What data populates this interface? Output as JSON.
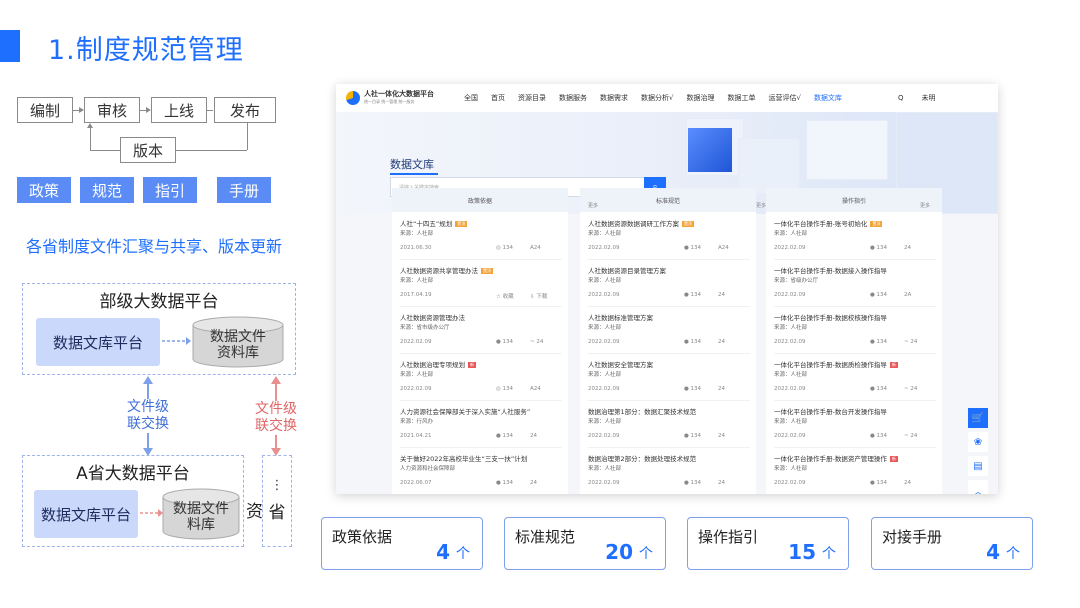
{
  "slide": {
    "title": "1.制度规范管理"
  },
  "flow": {
    "step1": "编制",
    "step2": "审核",
    "step3": "上线",
    "step4": "发布",
    "version": "版本"
  },
  "tags": [
    "政策",
    "规范",
    "指引",
    "手册"
  ],
  "subtitle": "各省制度文件汇聚与共享、版本更新",
  "diagram": {
    "ministry_title": "部级大数据平台",
    "doc_lib_platform": "数据文库平台",
    "data_file_repo_line1": "数据文件",
    "data_file_repo_line2": "资料库",
    "exchange_left_line1": "文件级",
    "exchange_left_line2": "联交换",
    "exchange_right_line1": "文件级",
    "exchange_right_line2": "联交换",
    "province_title": "A省大数据平台",
    "province_doc_lib_platform": "数据文库平台",
    "province_repo_line1": "数据文件",
    "province_repo_line2": "料库",
    "partial_cut": "资",
    "partial_box_dots": "⋮",
    "partial_box_text": "省",
    "exchange_left_color": "#3f6fd8",
    "exchange_right_color": "#e06666"
  },
  "portal": {
    "brand_main": "人社一体化大数据平台",
    "brand_sub": "统一目录 统一管理 统一服务",
    "nav": [
      "全国",
      "首页",
      "资源目录",
      "数据服务",
      "数据需求",
      "数据分析√",
      "数据治理",
      "数据工单",
      "运营评估√",
      "数据文库"
    ],
    "nav_right": [
      "Q",
      "未明"
    ],
    "hero_title": "数据文库",
    "search_placeholder": "请输入关键字搜索",
    "search_icon": "search-icon",
    "columns": [
      {
        "head": "政策依据",
        "more": "更多",
        "docs": [
          {
            "title": "人社“十四五”规划",
            "badge": "置顶",
            "source": "来源：人社部",
            "date": "2021.06.30",
            "views": "◎ 134",
            "extra": "A24"
          },
          {
            "title": "人社数据资源共享管理办法",
            "badge": "置顶",
            "source": "来源：人社部",
            "date": "2017.04.19",
            "views": "☆ 收藏",
            "extra": "⇩ 下载"
          },
          {
            "title": "人社数据资源管理办法",
            "badge": "",
            "source": "来源：省市级办公厅",
            "date": "2022.02.09",
            "views": "● 134",
            "extra": "~ 24"
          },
          {
            "title": "人社数据治理专项规划",
            "badge": "新",
            "source": "来源：人社部",
            "date": "2022.02.09",
            "views": "◎ 134",
            "extra": "A24"
          },
          {
            "title": "人力资源社会保障部关于深入实施“人社服务”",
            "badge": "",
            "source": "来源：行风办",
            "date": "2021.04.21",
            "views": "● 134",
            "extra": "24"
          },
          {
            "title": "关于做好2022年高校毕业生“三支一扶”计划",
            "badge": "",
            "source": "人力资源和社会保障部",
            "date": "2022.06.07",
            "views": "● 134",
            "extra": "24"
          }
        ]
      },
      {
        "head": "标准规范",
        "more": "更多",
        "docs": [
          {
            "title": "人社数据资源数据调研工作方案",
            "badge": "置顶",
            "source": "来源：人社部",
            "date": "2022.02.09",
            "views": "● 134",
            "extra": "A24"
          },
          {
            "title": "人社数据资源目录管理方案",
            "badge": "",
            "source": "来源：人社部",
            "date": "2022.02.09",
            "views": "● 134",
            "extra": "24"
          },
          {
            "title": "人社数据标准管理方案",
            "badge": "",
            "source": "来源：人社部",
            "date": "2022.02.09",
            "views": "● 134",
            "extra": "24"
          },
          {
            "title": "人社数据安全管理方案",
            "badge": "",
            "source": "来源：人社部",
            "date": "2022.02.09",
            "views": "● 134",
            "extra": "24"
          },
          {
            "title": "数据治理第1部分：数据汇聚技术规范",
            "badge": "",
            "source": "来源：人社部",
            "date": "2022.02.09",
            "views": "● 134",
            "extra": "24"
          },
          {
            "title": "数据治理第2部分：数据处理技术规范",
            "badge": "",
            "source": "来源：人社部",
            "date": "2022.02.09",
            "views": "● 134",
            "extra": "24"
          }
        ]
      },
      {
        "head": "操作指引",
        "more": "更多",
        "docs": [
          {
            "title": "一体化平台操作手册-账号初始化",
            "badge": "置顶",
            "source": "来源：人社部",
            "date": "2022.02.09",
            "views": "● 134",
            "extra": "24"
          },
          {
            "title": "一体化平台操作手册-数据接入操作指导",
            "badge": "",
            "source": "来源：省级办公厅",
            "date": "2022.02.09",
            "views": "● 134",
            "extra": "2A"
          },
          {
            "title": "一体化平台操作手册-数据校核操作指导",
            "badge": "",
            "source": "来源：人社部",
            "date": "2022.02.09",
            "views": "● 134",
            "extra": "~ 24"
          },
          {
            "title": "一体化平台操作手册-数据质检操作指导",
            "badge": "新",
            "source": "来源：人社部",
            "date": "2022.02.09",
            "views": "● 134",
            "extra": "~ 24"
          },
          {
            "title": "一体化平台操作手册-数台开发操作指导",
            "badge": "",
            "source": "来源：人社部",
            "date": "2022.02.09",
            "views": "● 134",
            "extra": "~ 24"
          },
          {
            "title": "一体化平台操作手册-数据资产管理操作",
            "badge": "新",
            "source": "来源：人社部",
            "date": "2022.02.09",
            "views": "● 134",
            "extra": "24"
          }
        ]
      }
    ],
    "tools": [
      "cart-icon",
      "palette-icon",
      "doc-icon",
      "up-icon"
    ]
  },
  "stats": [
    {
      "label": "政策依据",
      "value": "4",
      "unit": "个"
    },
    {
      "label": "标准规范",
      "value": "20",
      "unit": "个"
    },
    {
      "label": "操作指引",
      "value": "15",
      "unit": "个"
    },
    {
      "label": "对接手册",
      "value": "4",
      "unit": "个"
    }
  ]
}
